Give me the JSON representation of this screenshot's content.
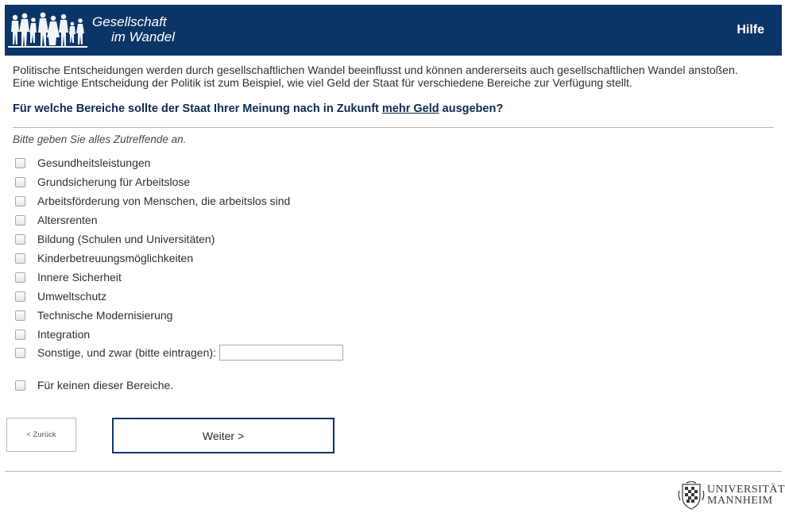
{
  "header": {
    "logo_line1": "Gesellschaft",
    "logo_line2": "im Wandel",
    "help_label": "Hilfe",
    "bg_color": "#0c3567"
  },
  "intro": {
    "line1": "Politische Entscheidungen werden durch gesellschaftlichen Wandel beeinflusst und können andererseits auch gesellschaftlichen Wandel anstoßen.",
    "line2": "Eine wichtige Entscheidung der Politik ist zum Beispiel, wie viel Geld der Staat für verschiedene Bereiche zur Verfügung stellt."
  },
  "question": {
    "prefix": "Für welche Bereiche sollte der Staat Ihrer Meinung nach in Zukunft ",
    "emphasis": "mehr Geld",
    "suffix": " ausgeben?"
  },
  "instruction": "Bitte geben Sie alles Zutreffende an.",
  "options": [
    "Gesundheitsleistungen",
    "Grundsicherung für Arbeitslose",
    "Arbeitsförderung von Menschen, die arbeitslos sind",
    "Altersrenten",
    "Bildung (Schulen und Universitäten)",
    "Kinderbetreuungsmöglichkeiten",
    "Innere Sicherheit",
    "Umweltschutz",
    "Technische Modernisierung",
    "Integration",
    "Sonstige, und zwar (bitte eintragen):"
  ],
  "other_input_value": "",
  "none_option": "Für keinen dieser Bereiche.",
  "buttons": {
    "back_label": "< Zurück",
    "next_label": "Weiter >"
  },
  "footer": {
    "university_line1": "UNIVERSITÄT",
    "university_line2": "MANNHEIM",
    "crest_icon": "university-crest-icon"
  }
}
